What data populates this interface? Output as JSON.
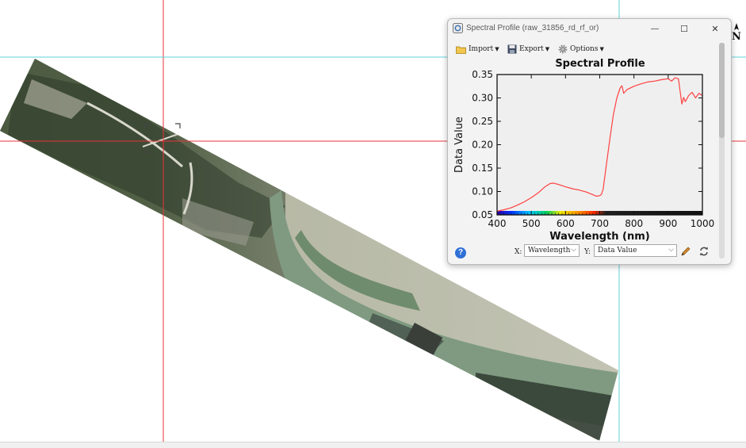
{
  "window": {
    "title": "Spectral Profile (raw_31856_rd_rf_or)",
    "controls": {
      "minimize": "—",
      "maximize": "☐",
      "close": "✕"
    }
  },
  "toolbar": {
    "import_label": "Import",
    "export_label": "Export",
    "options_label": "Options"
  },
  "map": {
    "north_label": "N"
  },
  "bottom": {
    "x_axis_prefix": "X:",
    "x_axis_value": "Wavelength",
    "y_axis_prefix": "Y:",
    "y_axis_value": "Data Value"
  },
  "icons": [
    "app-icon",
    "folder-icon",
    "floppy-disk-icon",
    "gear-icon",
    "help-icon",
    "pencil-icon",
    "reset-icon",
    "north-arrow-icon"
  ],
  "colors": {
    "series": "#ff4040",
    "crosshair_red": "#e8333a",
    "crosshair_cyan": "#5fd3dd",
    "help": "#2f6fd6"
  },
  "chart_data": {
    "type": "line",
    "title": "Spectral Profile",
    "xlabel": "Wavelength (nm)",
    "ylabel": "Data Value",
    "xlim": [
      400,
      1000
    ],
    "ylim": [
      0.05,
      0.35
    ],
    "xticks": [
      400,
      500,
      600,
      700,
      800,
      900,
      1000
    ],
    "yticks": [
      0.05,
      0.1,
      0.15,
      0.2,
      0.25,
      0.3,
      0.35
    ],
    "grid": false,
    "series": [
      {
        "color": "#ff4040",
        "x": [
          400,
          420,
          440,
          460,
          480,
          500,
          520,
          540,
          555,
          565,
          580,
          600,
          620,
          640,
          660,
          680,
          690,
          700,
          705,
          710,
          720,
          730,
          740,
          750,
          760,
          765,
          770,
          780,
          800,
          820,
          840,
          860,
          880,
          900,
          910,
          920,
          930,
          935,
          940,
          945,
          950,
          960,
          970,
          980,
          990,
          1000
        ],
        "y": [
          0.058,
          0.061,
          0.065,
          0.071,
          0.078,
          0.087,
          0.097,
          0.11,
          0.117,
          0.118,
          0.115,
          0.11,
          0.106,
          0.103,
          0.099,
          0.093,
          0.09,
          0.091,
          0.094,
          0.105,
          0.16,
          0.215,
          0.265,
          0.3,
          0.322,
          0.326,
          0.31,
          0.318,
          0.325,
          0.33,
          0.334,
          0.336,
          0.339,
          0.341,
          0.336,
          0.343,
          0.341,
          0.314,
          0.287,
          0.301,
          0.292,
          0.305,
          0.312,
          0.3,
          0.31,
          0.305
        ]
      }
    ]
  }
}
